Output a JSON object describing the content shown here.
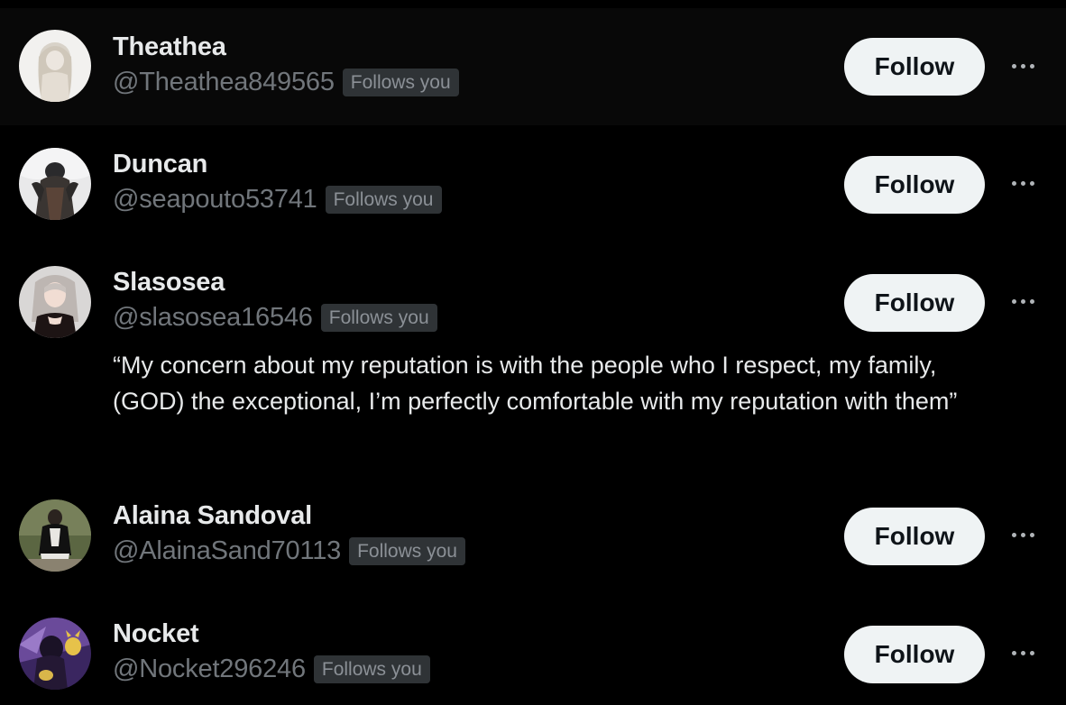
{
  "colors": {
    "background": "#000000",
    "hover_row": "#080808",
    "name_text": "#e7e9ea",
    "handle_text": "#71767b",
    "badge_bg": "#2f3336",
    "follow_button_bg": "#eff3f4",
    "follow_button_text": "#0f1419"
  },
  "users": [
    {
      "name": "Theathea",
      "handle": "@Theathea849565",
      "badge": "Follows you",
      "follow_label": "Follow",
      "more_icon": "more-horizontal-icon"
    },
    {
      "name": "Duncan",
      "handle": "@seapouto53741",
      "badge": "Follows you",
      "follow_label": "Follow",
      "more_icon": "more-horizontal-icon"
    },
    {
      "name": "Slasosea",
      "handle": "@slasosea16546",
      "badge": "Follows you",
      "bio": "“My concern about my reputation is with the people who I respect, my family, (GOD) the exceptional, I’m perfectly comfortable with my reputation with them”",
      "follow_label": "Follow",
      "more_icon": "more-horizontal-icon"
    },
    {
      "name": "Alaina Sandoval",
      "handle": "@AlainaSand70113",
      "badge": "Follows you",
      "follow_label": "Follow",
      "more_icon": "more-horizontal-icon"
    },
    {
      "name": "Nocket",
      "handle": "@Nocket296246",
      "badge": "Follows you",
      "follow_label": "Follow",
      "more_icon": "more-horizontal-icon"
    }
  ]
}
